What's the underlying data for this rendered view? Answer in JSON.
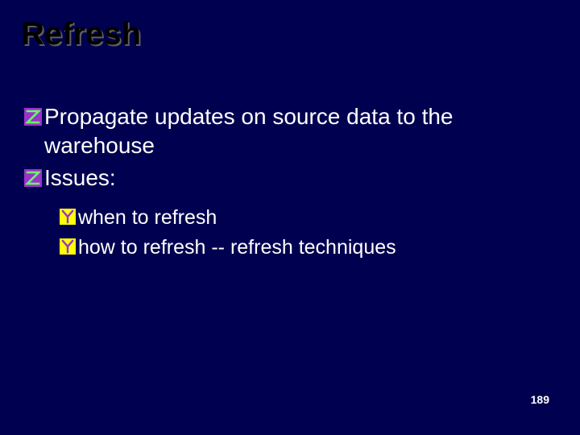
{
  "title": "Refresh",
  "bullets_level1": [
    {
      "text": "Propagate updates on source data to the warehouse"
    },
    {
      "text": "Issues:"
    }
  ],
  "bullets_level2": [
    {
      "text": "when to refresh"
    },
    {
      "text": "how to refresh -- refresh techniques"
    }
  ],
  "page_number": "189",
  "colors": {
    "background": "#000050",
    "text": "#ffffff",
    "title": "#000000",
    "bullet_z_bg": "#9933cc",
    "bullet_z_fg": "#66ff66",
    "bullet_y_bg": "#ffff00",
    "bullet_y_fg": "#9933cc"
  }
}
